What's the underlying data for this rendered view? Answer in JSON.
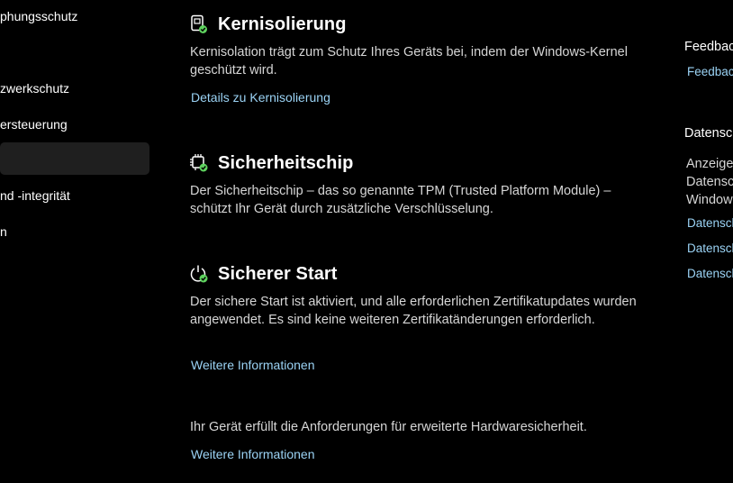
{
  "sidebar": {
    "items": [
      {
        "label": "phungsschutz",
        "top": 0
      },
      {
        "label": "zwerkschutz"
      },
      {
        "label": "ersteuerung"
      },
      {
        "label": ""
      },
      {
        "label": "nd -integrität"
      },
      {
        "label": "n"
      }
    ]
  },
  "sections": {
    "kernel": {
      "title": "Kernisolierung",
      "description": "Kernisolation trägt zum Schutz Ihres Geräts bei, indem der Windows-Kernel geschützt wird.",
      "link": "Details zu Kernisolierung",
      "icon": "core-isolation-icon"
    },
    "chip": {
      "title": "Sicherheitschip",
      "description": "Der Sicherheitschip – das so genannte TPM (Trusted Platform Module) – schützt Ihr Gerät durch zusätzliche Verschlüsselung.",
      "icon": "security-chip-icon"
    },
    "secureboot": {
      "title": "Sicherer Start",
      "description": "Der sichere Start ist aktiviert, und alle erforderlichen Zertifikatupdates wurden angewendet. Es sind keine weiteren Zertifikatänderungen erforderlich.",
      "link": "Weitere Informationen",
      "icon": "secure-boot-icon"
    },
    "hardware": {
      "description": "Ihr Gerät erfüllt die Anforderungen für erweiterte Hardwaresicherheit.",
      "link": "Weitere Informationen"
    }
  },
  "right_panel": {
    "feedback_heading": "Feedback",
    "feedback_link": "Feedback",
    "privacy_heading": "Datensc",
    "privacy_lines": [
      "Anzeige",
      "Datensc",
      "Window"
    ],
    "privacy_links": [
      "Datensch",
      "Datensch",
      "Datensch"
    ]
  },
  "colors": {
    "background": "#000000",
    "link": "#9bd3f5",
    "check_green": "#5fd35f",
    "selected_nav": "#1f1f1f"
  }
}
